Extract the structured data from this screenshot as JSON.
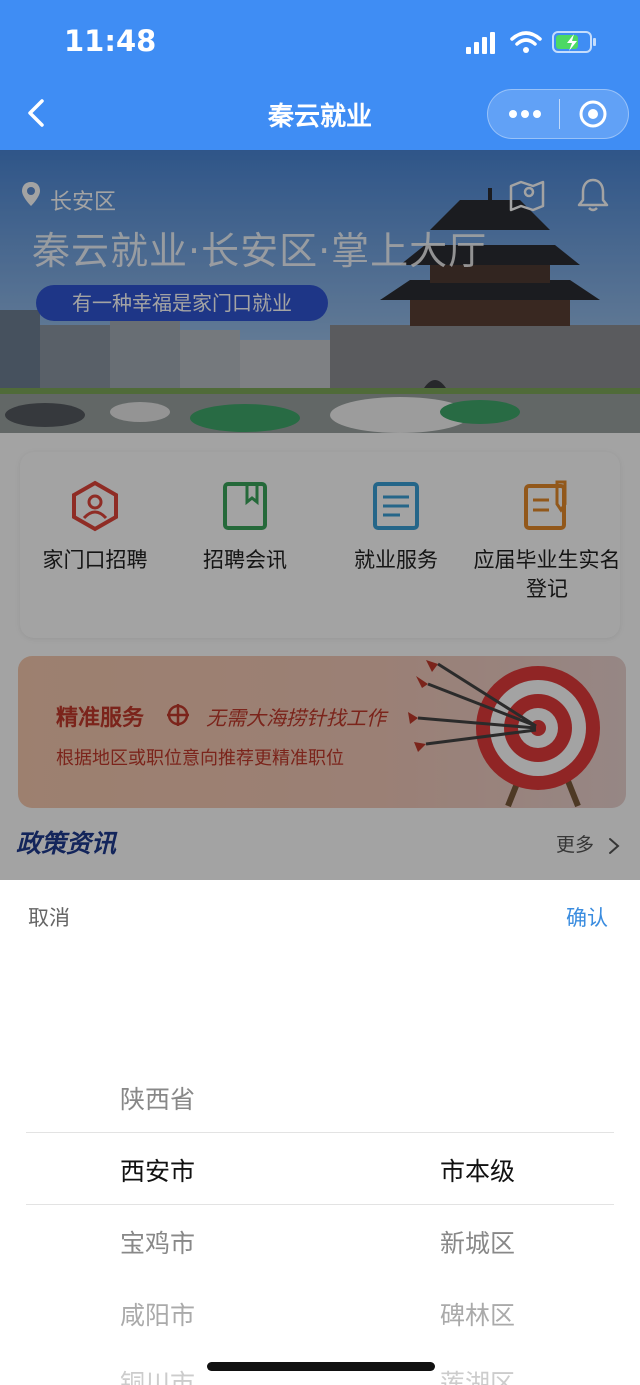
{
  "status_bar": {
    "time": "11:48"
  },
  "nav": {
    "title": "秦云就业"
  },
  "banner": {
    "location": "长安区",
    "title": "秦云就业·长安区·掌上大厅",
    "pill": "有一种幸福是家门口就业"
  },
  "services": [
    {
      "label": "家门口招聘",
      "icon": "person-hex-icon",
      "color": "#e0453b"
    },
    {
      "label": "招聘会讯",
      "icon": "bookmark-doc-icon",
      "color": "#3aa55c"
    },
    {
      "label": "就业服务",
      "icon": "list-doc-icon",
      "color": "#3aa0d6"
    },
    {
      "label": "应届毕业生实名登记",
      "icon": "pen-doc-icon",
      "color": "#e58a2b"
    }
  ],
  "promo": {
    "title": "精准服务",
    "slogan": "无需大海捞针找工作",
    "subtitle": "根据地区或职位意向推荐更精准职位"
  },
  "policy": {
    "title": "政策资讯",
    "more": "更多"
  },
  "picker": {
    "cancel": "取消",
    "confirm": "确认",
    "left_column": [
      "陕西省",
      "西安市",
      "宝鸡市",
      "咸阳市",
      "铜川市"
    ],
    "right_column": [
      "市本级",
      "新城区",
      "碑林区",
      "莲湖区"
    ],
    "selected_left": "西安市",
    "selected_right": "市本级"
  },
  "colors": {
    "brand": "#3f8df4",
    "confirm": "#3a8cdf",
    "promo_text": "#c0392b"
  }
}
